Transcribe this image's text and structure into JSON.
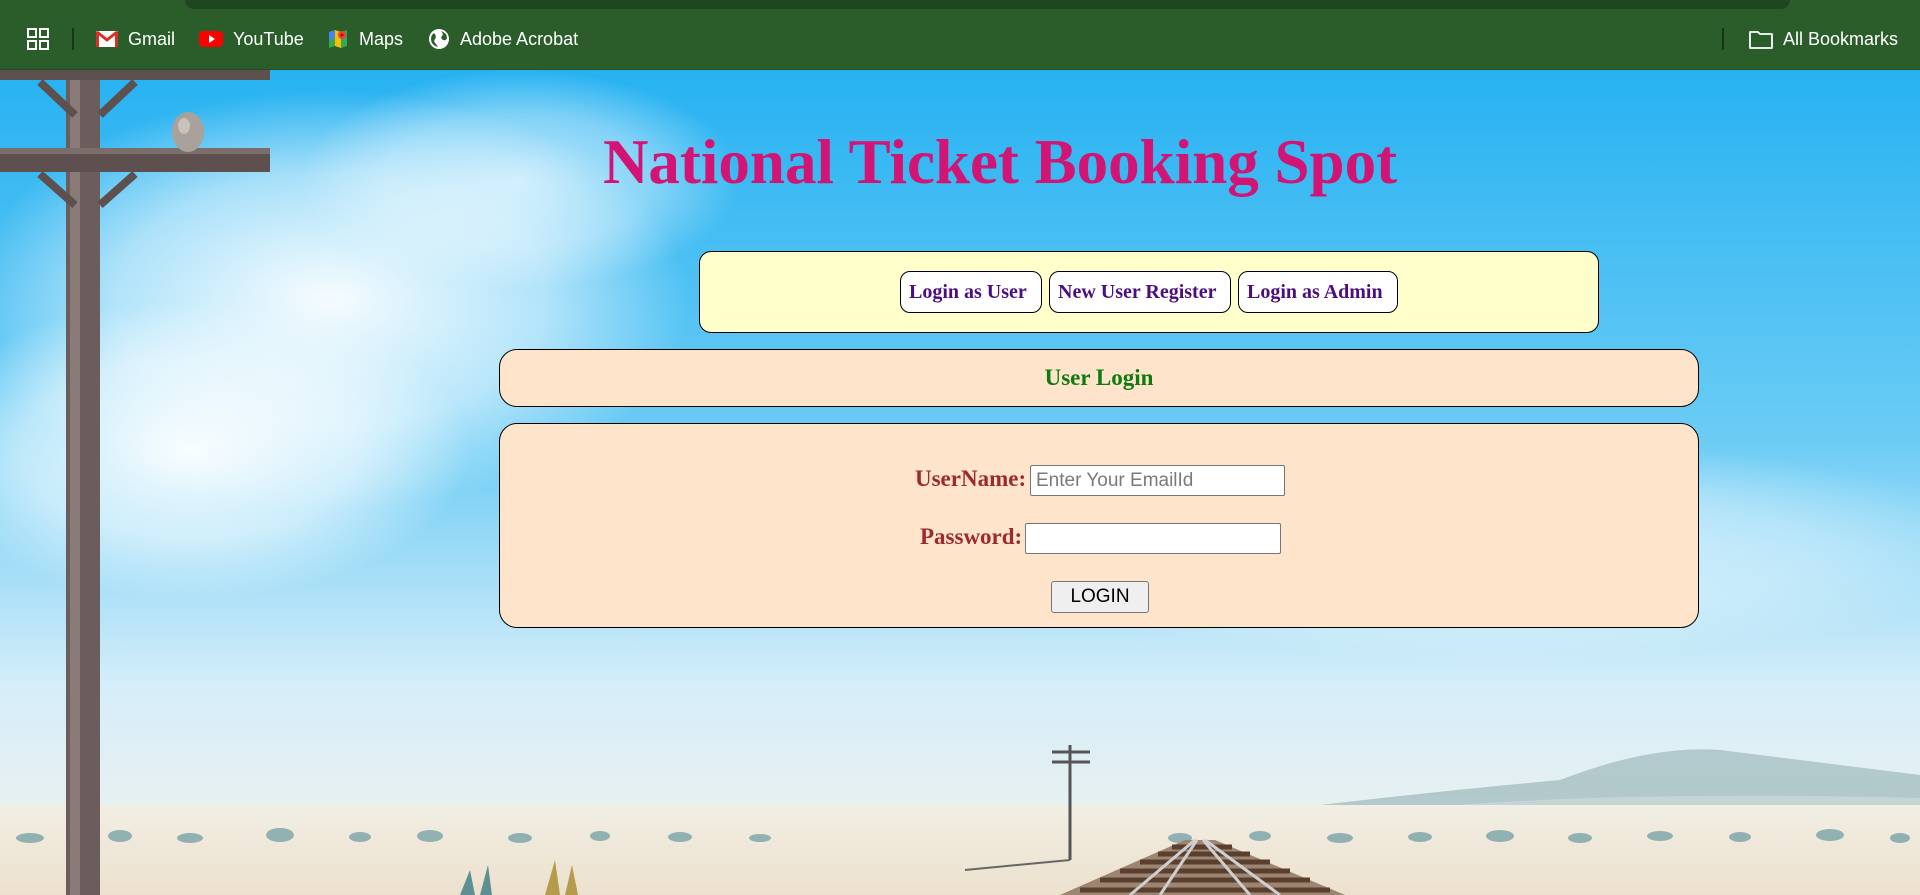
{
  "bookmarks_bar": {
    "items": [
      {
        "label": "Gmail",
        "icon": "gmail-icon"
      },
      {
        "label": "YouTube",
        "icon": "youtube-icon"
      },
      {
        "label": "Maps",
        "icon": "maps-icon"
      },
      {
        "label": "Adobe Acrobat",
        "icon": "globe-icon"
      }
    ],
    "all_bookmarks": "All Bookmarks",
    "background_color": "#2b5d2b"
  },
  "page": {
    "title": "National Ticket Booking Spot",
    "title_color": "#d21475",
    "nav": {
      "login_user": "Login as User",
      "register": "New User Register",
      "login_admin": "Login as Admin"
    },
    "section_heading": "User Login",
    "form": {
      "username_label": "UserName:",
      "username_placeholder": "Enter Your EmailId",
      "password_label": "Password:",
      "login_button": "LOGIN"
    }
  }
}
